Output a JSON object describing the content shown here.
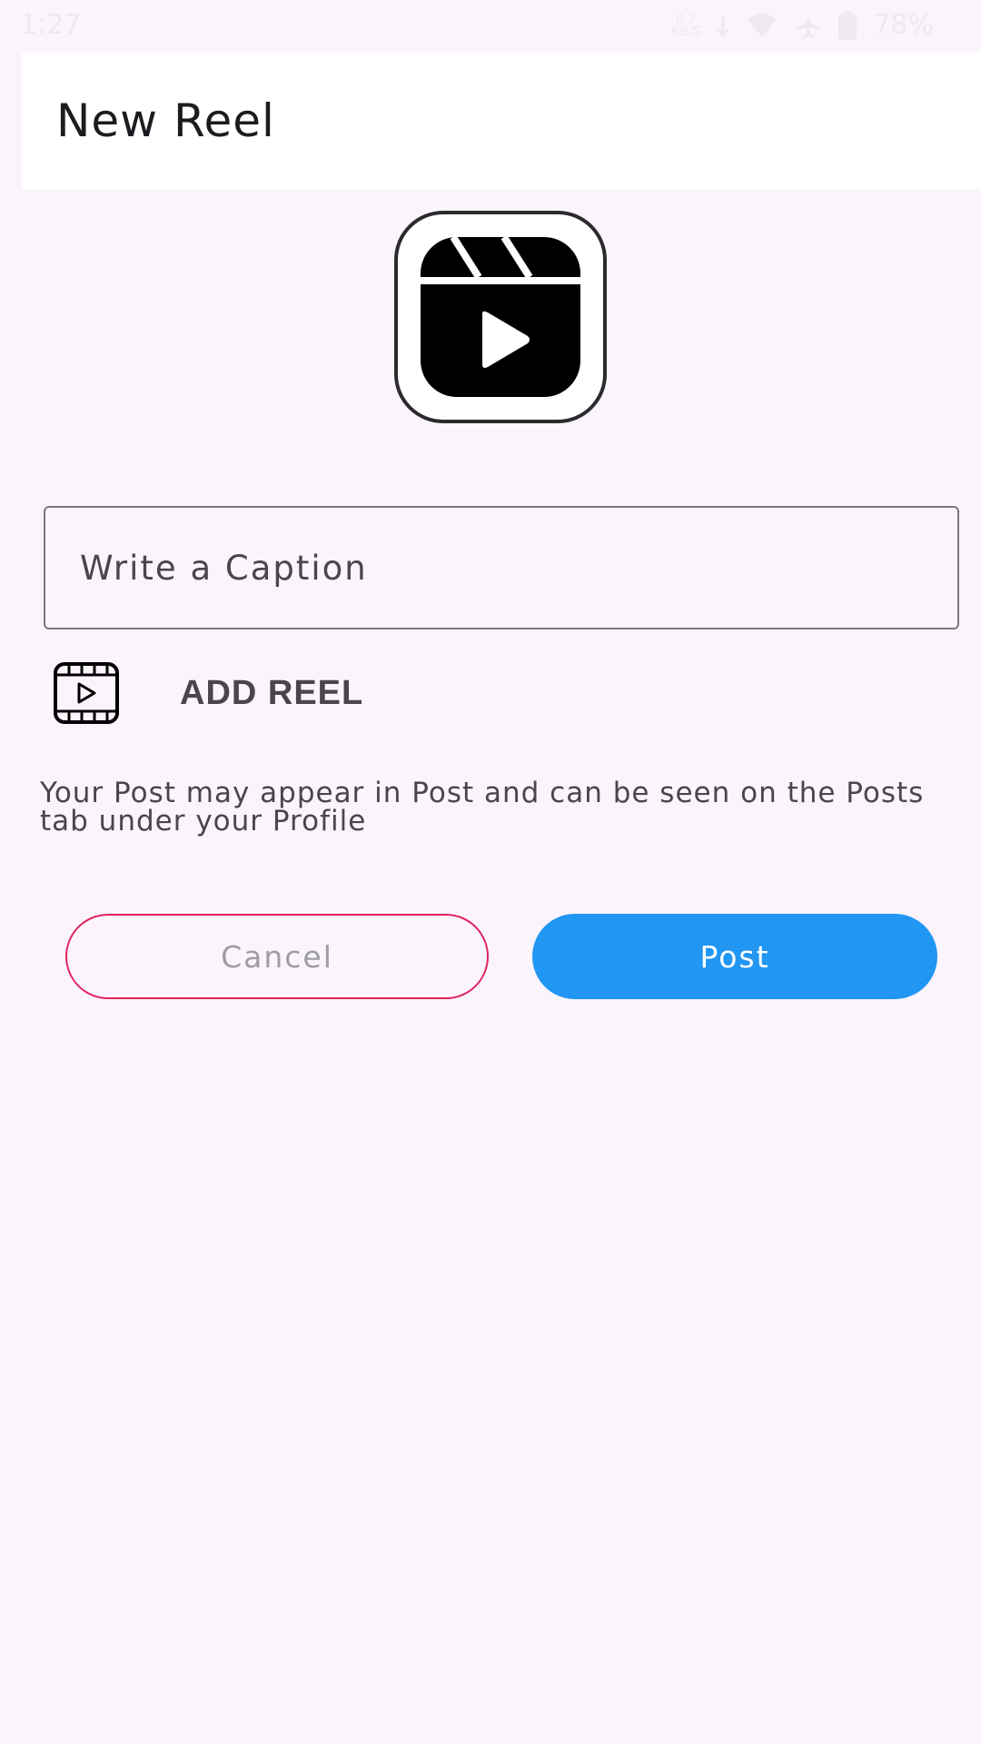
{
  "status_bar": {
    "time": "1:27",
    "net_speed": "0.2",
    "net_unit": "KB/S",
    "battery": "78%"
  },
  "app_bar": {
    "title": "New Reel"
  },
  "preview": {
    "icon": "reel-clapperboard-icon"
  },
  "caption": {
    "placeholder": "Write a Caption",
    "value": ""
  },
  "add_reel": {
    "icon": "film-play-icon",
    "label": "ADD REEL"
  },
  "notice": {
    "text": "Your Post may appear in Post and can be seen on the Posts tab under your Profile"
  },
  "actions": {
    "cancel_label": "Cancel",
    "post_label": "Post"
  },
  "colors": {
    "background": "#fcf4fc",
    "app_bar": "#ffffff",
    "post_button": "#2196f3",
    "cancel_border": "#e0245e",
    "cancel_text": "#9e9ea2"
  }
}
